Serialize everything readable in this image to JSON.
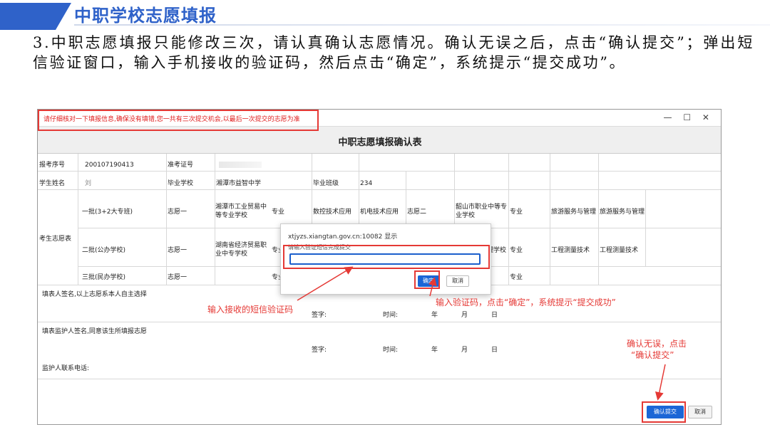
{
  "slide": {
    "title": "中职学校志愿填报",
    "paragraph": "3.中职志愿填报只能修改三次，请认真确认志愿情况。确认无误之后，点击“确认提交”；弹出短信验证窗口，输入手机接收的验证码，然后点击“确定”，系统提示“提交成功”。"
  },
  "window": {
    "warning": "请仔细核对一下填报信息,确保没有填错,您一共有三次提交机会,以最后一次提交的志愿为准",
    "controls": "— ☐ ✕",
    "form_title": "中职志愿填报确认表"
  },
  "table": {
    "exam_no_label": "报考序号",
    "exam_no": "200107190413",
    "ticket_label": "准考证号",
    "name_label": "学生姓名",
    "name_value": "刘",
    "grad_school_label": "毕业学校",
    "grad_school": "湘潭市益智中学",
    "class_label": "毕业班级",
    "class_value": "234",
    "wishes_label": "考生志愿表",
    "batch1": "一批(3+2大专班)",
    "batch2": "二批(公办学校)",
    "batch3": "三批(民办学校)",
    "wish1": "志愿一",
    "wish2": "志愿二",
    "school_b1_1": "湘潭市工业贸易中等专业学校",
    "major_label": "专业",
    "major_b1_1a": "数控技术应用",
    "major_b1_1b": "机电技术应用",
    "school_b1_2": "韶山市职业中等专业学校",
    "major_b1_2a": "旅游服务与管理",
    "major_b1_2b": "旅游服务与管理",
    "school_b2_1": "湖南省经济贸易职业中专学校",
    "school_b2_2_tail": "理学校",
    "major_b2_2a": "工程测量技术",
    "major_b2_2b": "工程测量技术",
    "signer_statement": "填表人签名,以上志愿系本人自主选择",
    "guardian_statement": "填表监护人签名,同意该生所填报志愿",
    "guardian_phone": "监护人联系电话:",
    "sign": "签字:",
    "time": "时间:",
    "year": "年",
    "month": "月",
    "day": "日"
  },
  "modal": {
    "host": "xtjyzs.xiangtan.gov.cn:10082 显示",
    "prompt": "请输入验证短信完成提交",
    "input_value": "",
    "ok": "确定",
    "cancel": "取消"
  },
  "annotations": {
    "input_code": "输入接收的短信验证码",
    "click_ok": "输入验证码，点击“确定”，系统提示“提交成功”",
    "confirm_line1": "确认无误，点击",
    "confirm_line2": "“确认提交”"
  },
  "buttons": {
    "submit": "确认提交",
    "cancel": "取消"
  },
  "colors": {
    "accent_blue": "#2f62c9",
    "button_blue": "#1b66d6",
    "annotation_red": "#e53935"
  }
}
